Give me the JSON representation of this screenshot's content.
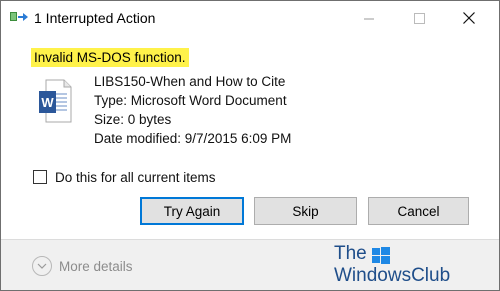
{
  "window": {
    "title": "1 Interrupted Action",
    "minimize_icon": "minimize-icon",
    "maximize_icon": "maximize-icon",
    "close_icon": "close-icon"
  },
  "error": {
    "message": "Invalid MS-DOS function.",
    "highlight_color": "#fff24a"
  },
  "file": {
    "icon": "word-document-icon",
    "name": "LIBS150-When and How to Cite",
    "type": "Type: Microsoft Word Document",
    "size": "Size: 0 bytes",
    "modified": "Date modified: 9/7/2015 6:09 PM"
  },
  "checkbox": {
    "label": "Do this for all current items",
    "checked": false
  },
  "buttons": {
    "try_again": "Try Again",
    "skip": "Skip",
    "cancel": "Cancel"
  },
  "footer": {
    "more_details": "More details"
  },
  "watermark": {
    "line1": "The",
    "line2": "WindowsClub"
  },
  "colors": {
    "accent": "#0078d7",
    "word_blue": "#2b579a",
    "watermark": "#1f4e8a"
  }
}
